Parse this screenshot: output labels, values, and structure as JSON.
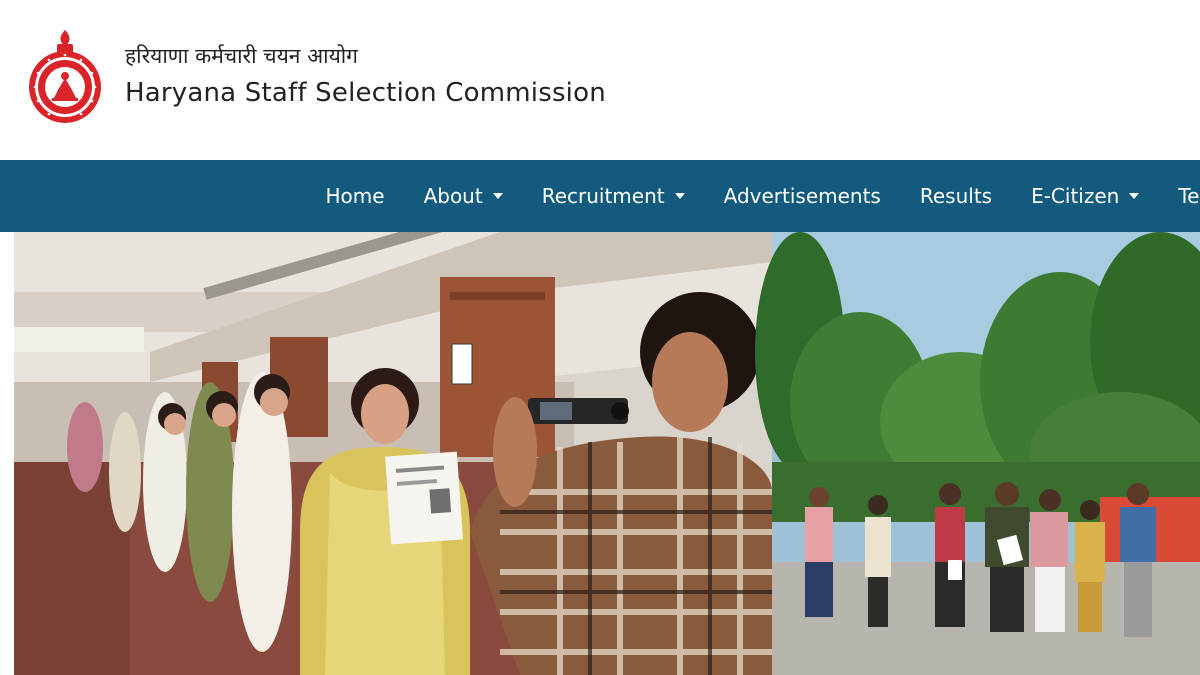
{
  "header": {
    "title_hindi": "हरियाणा कर्मचारी चयन आयोग",
    "title_english": "Haryana Staff Selection Commission",
    "emblem_icon": "haryana-emblem-icon"
  },
  "nav": {
    "items": [
      {
        "label": "Home",
        "dropdown": false
      },
      {
        "label": "About",
        "dropdown": true
      },
      {
        "label": "Recruitment",
        "dropdown": true
      },
      {
        "label": "Advertisements",
        "dropdown": false
      },
      {
        "label": "Results",
        "dropdown": false
      },
      {
        "label": "E-Citizen",
        "dropdown": true
      },
      {
        "label": "Ter",
        "dropdown": false
      }
    ]
  },
  "banner": {
    "left_photo": "candidates-queue-verification-photo",
    "right_photo": "candidates-outdoor-queue-photo"
  },
  "colors": {
    "nav_background": "#135b7e",
    "nav_text": "#ffffff",
    "title_text": "#222222"
  }
}
